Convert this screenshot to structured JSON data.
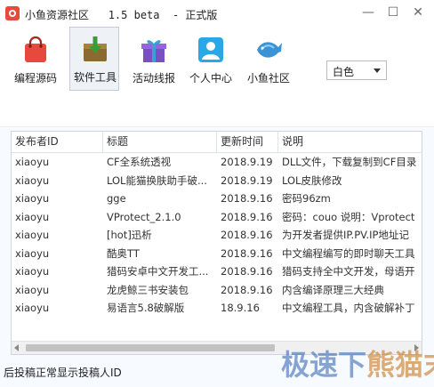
{
  "window": {
    "title_name": "小鱼资源社区",
    "version": "1.5 beta",
    "edition_sep": "-",
    "edition": "正式版",
    "min_label": "—",
    "max_label": "☐",
    "close_label": "✕"
  },
  "toolbar": {
    "items": [
      {
        "label": "编程源码",
        "icon": "shopping-bag-icon",
        "active": false
      },
      {
        "label": "软件工具",
        "icon": "download-box-icon",
        "active": true
      },
      {
        "label": "活动线报",
        "icon": "gift-box-icon",
        "active": false
      },
      {
        "label": "个人中心",
        "icon": "user-profile-icon",
        "active": false
      },
      {
        "label": "小鱼社区",
        "icon": "fish-icon",
        "active": false
      }
    ],
    "theme_select": {
      "value": "白色"
    }
  },
  "table": {
    "columns": [
      "发布者ID",
      "标题",
      "更新时间",
      "说明"
    ],
    "rows": [
      [
        "xiaoyu",
        "CF全系统透视",
        "2018.9.19",
        "DLL文件，下载复制到CF目录"
      ],
      [
        "xiaoyu",
        "LOL能猫换肤助手破...",
        "2018.9.19",
        "LOL皮肤修改"
      ],
      [
        "xiaoyu",
        "gge",
        "2018.9.16",
        "密码96zm"
      ],
      [
        "xiaoyu",
        "VProtect_2.1.0",
        "2018.9.16",
        "密码：couo 说明：Vprotect"
      ],
      [
        "xiaoyu",
        "[hot]迅析",
        "2018.9.16",
        "为开发者提供IP.PV.IP地址记"
      ],
      [
        "xiaoyu",
        "酷奥TT",
        "2018.9.16",
        "中文编程编写的即时聊天工具"
      ],
      [
        "xiaoyu",
        "猎码安卓中文开发工...",
        "2018.9.16",
        "猎码支持全中文开发，母语开"
      ],
      [
        "xiaoyu",
        "龙虎鲸三书安装包",
        "2018.9.16",
        "内含编译原理三大经典"
      ],
      [
        "xiaoyu",
        "易语言5.8破解版",
        "18.9.16",
        "中文编程工具，内含破解补丁"
      ]
    ]
  },
  "status": {
    "text": "后投稿正常显示投稿人ID"
  },
  "watermark": {
    "text_main": "极速下",
    "text_accent": "熊猫末"
  },
  "colors": {
    "accent_blue": "#2b8fd6",
    "window_bg": "#f7fbff",
    "grid_border": "#cfd6de"
  }
}
